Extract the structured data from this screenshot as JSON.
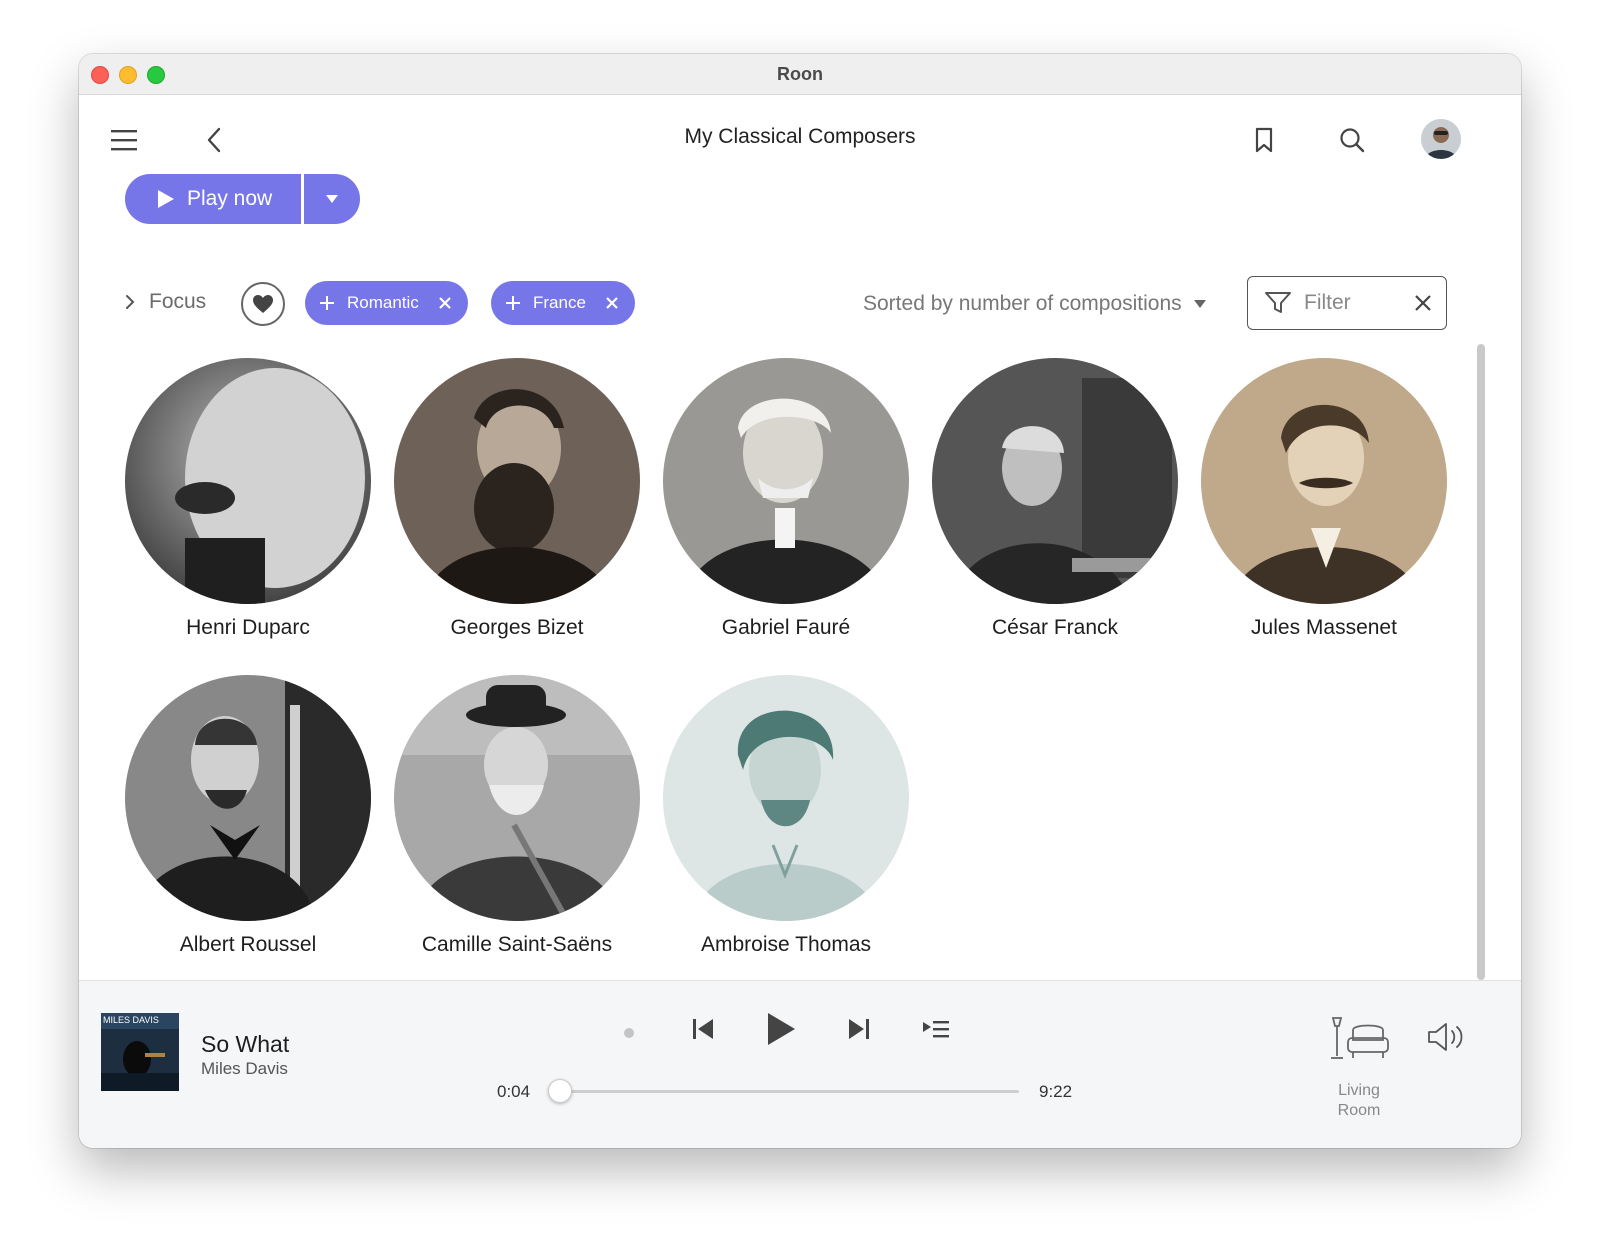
{
  "window": {
    "title": "Roon"
  },
  "header": {
    "title": "My Classical Composers",
    "menu_icon": "hamburger-icon",
    "back_icon": "chevron-left-icon",
    "bookmark_icon": "bookmark-icon",
    "search_icon": "search-icon",
    "avatar_icon": "user-avatar"
  },
  "actions": {
    "play_now_label": "Play now"
  },
  "filters": {
    "focus_label": "Focus",
    "chips": [
      {
        "label": "Romantic"
      },
      {
        "label": "France"
      }
    ],
    "sort_label": "Sorted by number of compositions",
    "filter_placeholder": "Filter"
  },
  "composers": [
    {
      "name": "Henri Duparc"
    },
    {
      "name": "Georges Bizet"
    },
    {
      "name": "Gabriel Fauré"
    },
    {
      "name": "César Franck"
    },
    {
      "name": "Jules Massenet"
    },
    {
      "name": "Albert Roussel"
    },
    {
      "name": "Camille Saint-Saëns"
    },
    {
      "name": "Ambroise Thomas"
    }
  ],
  "player": {
    "track_title": "So What",
    "artist": "Miles Davis",
    "album_art_text": "MILES DAVIS",
    "elapsed": "0:04",
    "duration": "9:22",
    "progress_fraction": 0.007,
    "zone_line1": "Living",
    "zone_line2": "Room"
  },
  "colors": {
    "accent": "#7676e8",
    "traffic_red": "#fe5f57",
    "traffic_yellow": "#febc2e",
    "traffic_green": "#28c840"
  }
}
